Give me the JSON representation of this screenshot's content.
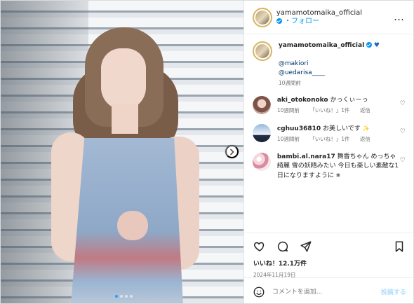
{
  "post": {
    "author": "yamamotomaika_official",
    "follow_label": "フォロー",
    "more_label": "…",
    "caption": {
      "author": "yamamotomaika_official",
      "mentions": [
        "@makiori",
        "@uedarisa____"
      ],
      "time": "10週間前"
    },
    "comments": [
      {
        "user": "aki_otokonoko",
        "text": "かっくぃーっ",
        "time": "10週間前",
        "likes": "「いいね！」1件",
        "reply": "返信"
      },
      {
        "user": "cghuu36810",
        "text": "お美しいです",
        "time": "10週間前",
        "likes": "「いいね！」1件",
        "reply": "返信"
      },
      {
        "user": "bambi.al.nara17",
        "text": "舞香ちゃん めっちゃ綺麗 雪の妖精みたい 今日も楽しい素敵な1日になりますように",
        "time": "",
        "likes": "",
        "reply": ""
      }
    ],
    "like_count": "いいね！12.1万件",
    "date": "2024年11月19日",
    "comment_placeholder": "コメントを追加...",
    "post_label": "投稿する"
  },
  "icons": {
    "verified": "verified-icon",
    "heart": "heart-icon",
    "comment": "comment-icon",
    "share": "share-icon",
    "bookmark": "bookmark-icon",
    "emoji": "emoji-icon",
    "next": "chevron-right-icon"
  }
}
